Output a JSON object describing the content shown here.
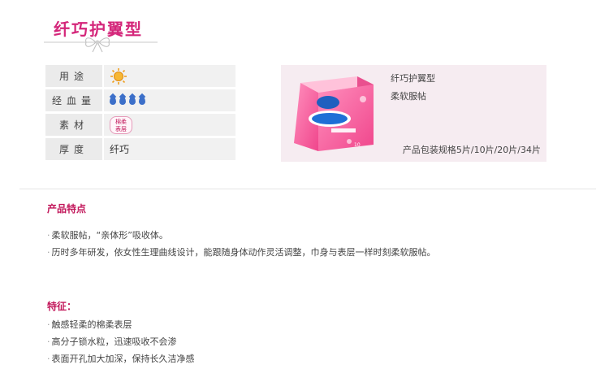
{
  "header": {
    "title": "纤巧护翼型"
  },
  "specs": [
    {
      "label": "用途",
      "value": ""
    },
    {
      "label": "经血量",
      "value": ""
    },
    {
      "label": "素材",
      "value": ""
    },
    {
      "label": "厚度",
      "value": "纤巧"
    }
  ],
  "icons": {
    "usage": "sun-icon",
    "flow": "water-drop-icon",
    "flow_drop_count": 4,
    "material": "fabric-badge-icon"
  },
  "material_badge": [
    "棉柔",
    "表层"
  ],
  "product": {
    "name": "纤巧护翼型",
    "feature": "柔软服帖",
    "pack": "产品包装规格5片/10片/20片/34片",
    "package_count": "10"
  },
  "features_section": {
    "heading": "产品特点",
    "items": [
      "柔软服帖，“亲体形”吸收体。",
      "历时多年研发，依女性生理曲线设计，能跟随身体动作灵活调整，巾身与表层一样时刻柔软服帖。"
    ]
  },
  "traits_section": {
    "heading": "特征：",
    "items": [
      "触感轻柔的棉柔表层",
      "高分子锁水粒，迅速吸收不会渗",
      "表面开孔加大加深，保持长久洁净感"
    ]
  },
  "colors": {
    "accent": "#d4267a",
    "heading": "#c2185b",
    "card_bg": "#f6ecf1",
    "drop": "#3c6fc9"
  }
}
